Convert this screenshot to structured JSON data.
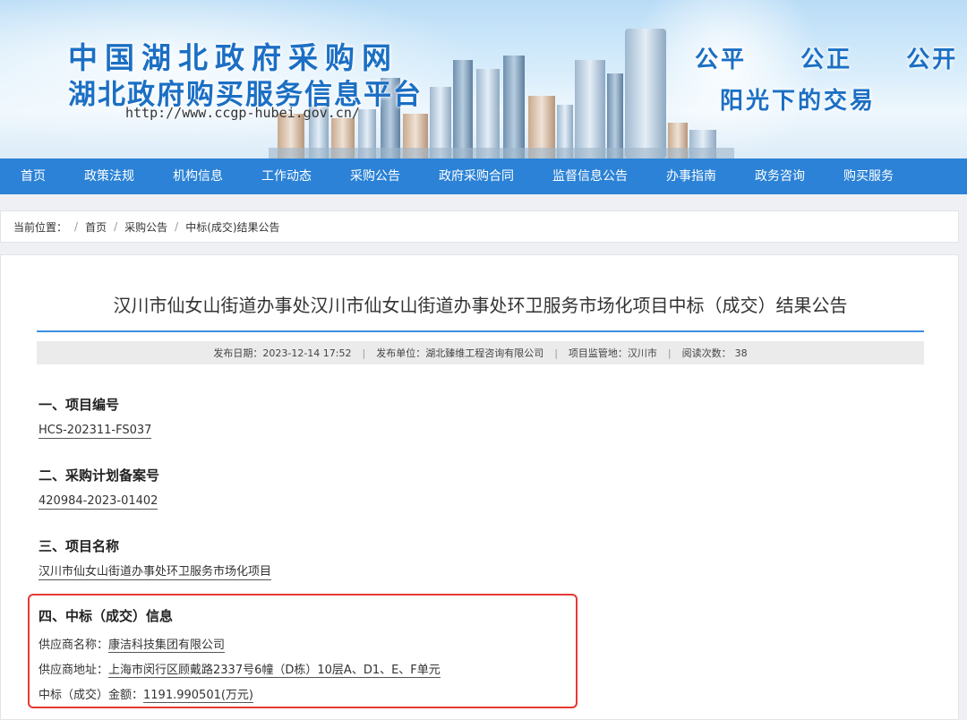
{
  "banner": {
    "title_line1": "中国湖北政府采购网",
    "title_line2": "湖北政府购买服务信息平台",
    "url": "http://www.ccgp-hubei.gov.cn/",
    "slogan_line1": "公平  公正  公开",
    "slogan_line2": "阳光下的交易"
  },
  "nav": {
    "items": [
      {
        "label": "首页"
      },
      {
        "label": "政策法规"
      },
      {
        "label": "机构信息"
      },
      {
        "label": "工作动态"
      },
      {
        "label": "采购公告"
      },
      {
        "label": "政府采购合同"
      },
      {
        "label": "监督信息公告"
      },
      {
        "label": "办事指南"
      },
      {
        "label": "政务咨询"
      },
      {
        "label": "购买服务"
      }
    ]
  },
  "breadcrumb": {
    "prefix": "当前位置：",
    "items": [
      "首页",
      "采购公告",
      "中标(成交)结果公告"
    ]
  },
  "article": {
    "title": "汉川市仙女山街道办事处汉川市仙女山街道办事处环卫服务市场化项目中标（成交）结果公告",
    "meta": {
      "date_label": "发布日期：",
      "date_value": "2023-12-14 17:52",
      "publisher_label": "发布单位：",
      "publisher_value": "湖北臻维工程咨询有限公司",
      "region_label": "项目监管地：",
      "region_value": "汉川市",
      "views_label": "阅读次数：",
      "views_value": "38"
    },
    "sections": [
      {
        "heading": "一、项目编号",
        "value": "HCS-202311-FS037"
      },
      {
        "heading": "二、采购计划备案号",
        "value": "420984-2023-01402"
      },
      {
        "heading": "三、项目名称",
        "value": "汉川市仙女山街道办事处环卫服务市场化项目"
      }
    ],
    "award": {
      "heading": "四、中标（成交）信息",
      "supplier_name_label": "供应商名称：",
      "supplier_name_value": "康洁科技集团有限公司",
      "supplier_address_label": "供应商地址：",
      "supplier_address_value": "上海市闵行区顾戴路2337号6幢（D栋）10层A、D1、E、F单元",
      "amount_label": "中标（成交）金额：",
      "amount_value": "1191.990501(万元)"
    }
  },
  "colors": {
    "nav_bg": "#2b82d6",
    "brand_blue": "#1b6fc4",
    "rule_blue": "#3d8fe0",
    "highlight_red": "#e53935"
  }
}
